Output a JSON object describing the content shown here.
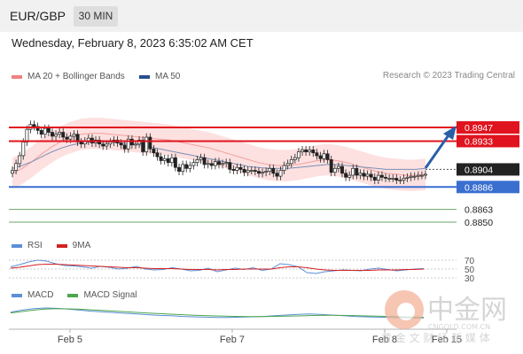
{
  "header": {
    "symbol": "EUR/GBP",
    "interval": "30 MIN",
    "datetime": "Wednesday, February 8, 2023 6:35:02 AM CET"
  },
  "credit": "Research © 2023 Trading Central",
  "watermark": {
    "brand": "中金网",
    "sub": "CNGOLD.COM.CN",
    "tagline": "黄 金 文 财 经 新 媒 体"
  },
  "colors": {
    "bb": "#f08080",
    "ma50": "#2b4f8f",
    "resistance": "#e0141e",
    "support": "#3a6fd0",
    "target": "#6aa56a",
    "arrow": "#2a5fa8"
  },
  "chart_data": {
    "type": "candlestick",
    "x_ticks": [
      "Feb 5",
      "Feb 7",
      "Feb 8",
      "Feb 15"
    ],
    "legend": [
      {
        "name": "MA 20 + Bollinger Bands",
        "color": "#f08080"
      },
      {
        "name": "MA 50",
        "color": "#2b4f8f"
      }
    ],
    "price_range": [
      0.884,
      0.8965
    ],
    "last_price": 0.8904,
    "levels": [
      {
        "label": "0.8947",
        "value": 0.8947,
        "kind": "resistance"
      },
      {
        "label": "0.8933",
        "value": 0.8933,
        "kind": "resistance"
      },
      {
        "label": "0.8904",
        "value": 0.8904,
        "kind": "last"
      },
      {
        "label": "0.8886",
        "value": 0.8886,
        "kind": "pivot"
      },
      {
        "label": "0.8863",
        "value": 0.8863,
        "kind": "target"
      },
      {
        "label": "0.8850",
        "value": 0.885,
        "kind": "target"
      }
    ],
    "close": [
      0.8903,
      0.891,
      0.8918,
      0.8932,
      0.8945,
      0.895,
      0.8948,
      0.8944,
      0.894,
      0.8946,
      0.8942,
      0.8938,
      0.894,
      0.8942,
      0.8937,
      0.8935,
      0.8938,
      0.894,
      0.8932,
      0.893,
      0.8933,
      0.8936,
      0.8931,
      0.8934,
      0.893,
      0.8928,
      0.893,
      0.8932,
      0.8934,
      0.8931,
      0.8929,
      0.8925,
      0.8935,
      0.8929,
      0.893,
      0.8934,
      0.8922,
      0.8937,
      0.8925,
      0.8921,
      0.8917,
      0.8913,
      0.8915,
      0.8911,
      0.8916,
      0.8906,
      0.8902,
      0.8909,
      0.8905,
      0.8908,
      0.8911,
      0.8914,
      0.8916,
      0.8909,
      0.891,
      0.8908,
      0.8912,
      0.8909,
      0.891,
      0.8911,
      0.8904,
      0.8903,
      0.8906,
      0.8904,
      0.8901,
      0.8903,
      0.8903,
      0.8902,
      0.89,
      0.8901,
      0.8902,
      0.8905,
      0.89,
      0.8897,
      0.8903,
      0.8908,
      0.891,
      0.8914,
      0.8916,
      0.8922,
      0.8924,
      0.8922,
      0.8924,
      0.8921,
      0.8918,
      0.8915,
      0.892,
      0.8914,
      0.8901,
      0.8905,
      0.8907,
      0.89,
      0.8896,
      0.8898,
      0.8905,
      0.8898,
      0.89,
      0.8897,
      0.8899,
      0.8896,
      0.8893,
      0.8898,
      0.8896,
      0.8895,
      0.8895,
      0.8895,
      0.8893,
      0.8893,
      0.8895,
      0.8896,
      0.8897,
      0.8897,
      0.8898,
      0.8898,
      0.8899
    ],
    "ma20_mid": [
      0.89,
      0.8905,
      0.8912,
      0.892,
      0.8927,
      0.8933,
      0.8937,
      0.894,
      0.8941,
      0.8941,
      0.894,
      0.8939,
      0.8938,
      0.8937,
      0.8936,
      0.8935,
      0.8934,
      0.8932,
      0.893,
      0.8928,
      0.8926,
      0.8923,
      0.892,
      0.8917,
      0.8914,
      0.8911,
      0.8909,
      0.8908,
      0.8908,
      0.8909,
      0.8911,
      0.8913,
      0.8914,
      0.8913,
      0.8911,
      0.8908,
      0.8905,
      0.8902,
      0.89,
      0.8899,
      0.8898,
      0.8898,
      0.8899
    ],
    "ma50": [
      0.8905,
      0.8908,
      0.8912,
      0.8917,
      0.8922,
      0.8926,
      0.8929,
      0.8931,
      0.8932,
      0.8932,
      0.8932,
      0.8931,
      0.893,
      0.8929,
      0.8927,
      0.8925,
      0.8923,
      0.8921,
      0.8919,
      0.8917,
      0.8915,
      0.8913,
      0.8911,
      0.8909,
      0.8907,
      0.8906,
      0.8905,
      0.8905,
      0.8905,
      0.8906,
      0.8907,
      0.8908,
      0.8909,
      0.8909,
      0.8908,
      0.8907,
      0.8906,
      0.8905,
      0.8904,
      0.8904,
      0.8904,
      0.8904,
      0.8905
    ],
    "rsi": {
      "legend": [
        {
          "name": "RSI",
          "color": "#5b8fd6"
        },
        {
          "name": "9MA",
          "color": "#d42020"
        }
      ],
      "levels": [
        70,
        50,
        30
      ],
      "rsi": [
        55,
        60,
        66,
        70,
        68,
        62,
        58,
        57,
        55,
        52,
        56,
        54,
        50,
        52,
        56,
        50,
        48,
        49,
        53,
        50,
        46,
        47,
        52,
        44,
        48,
        52,
        49,
        53,
        47,
        50,
        62,
        60,
        55,
        42,
        40,
        44,
        46,
        48,
        47,
        46,
        50,
        52,
        49,
        46,
        48,
        50,
        51
      ],
      "ma9": [
        52,
        54,
        57,
        60,
        61,
        61,
        60,
        59,
        58,
        57,
        56,
        55,
        54,
        53,
        53,
        52,
        51,
        51,
        51,
        50,
        49,
        49,
        49,
        48,
        49,
        49,
        50,
        50,
        50,
        50,
        53,
        55,
        55,
        53,
        50,
        48,
        47,
        47,
        47,
        47,
        47,
        48,
        48,
        48,
        49,
        49,
        50
      ]
    },
    "macd": {
      "legend": [
        {
          "name": "MACD",
          "color": "#5b8fd6"
        },
        {
          "name": "MACD Signal",
          "color": "#4ca64c"
        }
      ],
      "macd": [
        0.4,
        0.7,
        0.9,
        1.0,
        0.95,
        0.85,
        0.7,
        0.55,
        0.45,
        0.35,
        0.25,
        0.15,
        0.05,
        -0.05,
        -0.1,
        -0.2,
        -0.25,
        -0.3,
        -0.35,
        -0.35,
        -0.3,
        -0.25,
        -0.2,
        -0.1,
        0.0,
        0.1,
        0.15,
        0.1,
        0.0,
        -0.1,
        -0.2,
        -0.25,
        -0.3,
        -0.35,
        -0.38,
        -0.4,
        -0.4
      ],
      "signal": [
        0.3,
        0.5,
        0.7,
        0.85,
        0.9,
        0.88,
        0.82,
        0.74,
        0.65,
        0.56,
        0.47,
        0.38,
        0.29,
        0.2,
        0.12,
        0.05,
        -0.02,
        -0.08,
        -0.13,
        -0.17,
        -0.2,
        -0.21,
        -0.21,
        -0.19,
        -0.16,
        -0.12,
        -0.08,
        -0.05,
        -0.04,
        -0.05,
        -0.08,
        -0.12,
        -0.16,
        -0.2,
        -0.24,
        -0.28,
        -0.31
      ]
    }
  }
}
